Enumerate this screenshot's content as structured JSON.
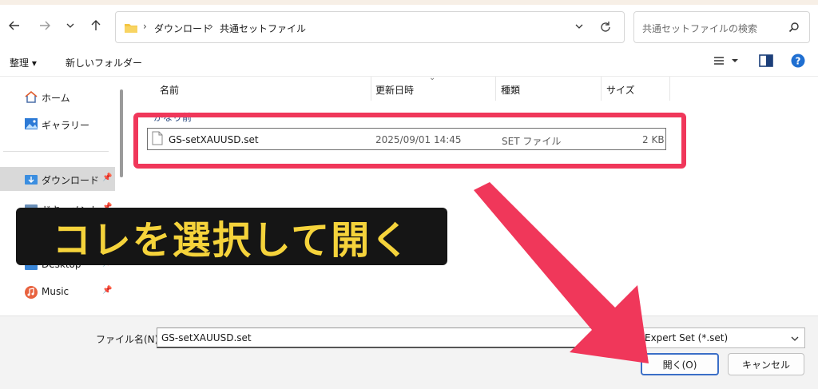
{
  "breadcrumbs": [
    "ダウンロード",
    "共通セットファイル"
  ],
  "search": {
    "placeholder": "共通セットファイルの検索"
  },
  "toolbar": {
    "organize": "整理 ▾",
    "new_folder": "新しいフォルダー"
  },
  "sidebar": {
    "items": [
      {
        "label": "ホーム",
        "icon": "home-icon"
      },
      {
        "label": "ギャラリー",
        "icon": "gallery-icon"
      },
      {
        "label": "ダウンロード",
        "icon": "downloads-folder-icon",
        "pinned": true,
        "selected": true
      },
      {
        "label": "ドキュメント",
        "icon": "documents-folder-icon",
        "pinned": true
      },
      {
        "label": "Desktop",
        "icon": "desktop-folder-icon",
        "pinned": true
      },
      {
        "label": "Music",
        "icon": "music-icon",
        "pinned": true
      }
    ]
  },
  "columns": {
    "name": "名前",
    "date": "更新日時",
    "type": "種類",
    "size": "サイズ"
  },
  "group_label": "かなり前",
  "files": [
    {
      "name": "GS-setXAUUSD.set",
      "date": "2025/09/01 14:45",
      "type": "SET ファイル",
      "size": "2 KB"
    }
  ],
  "bottom": {
    "filename_label": "ファイル名(N):",
    "filename_value": "GS-setXAUUSD.set",
    "filetype_value": "Expert Set (*.set)",
    "open_button": "開く(O)",
    "cancel_button": "キャンセル"
  },
  "annotation": {
    "caption": "コレを選択して開く"
  },
  "colors": {
    "highlight": "#f0375a",
    "caption_text": "#f5d33b",
    "caption_bg": "#151515",
    "accent": "#3b6fc7"
  }
}
